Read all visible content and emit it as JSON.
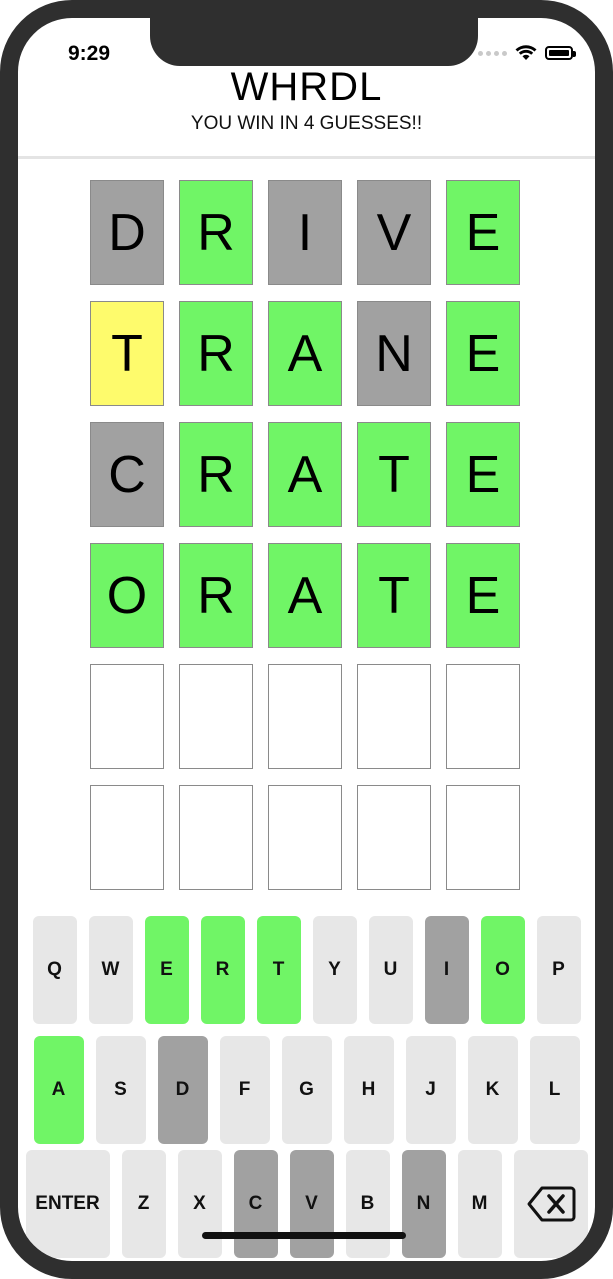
{
  "status": {
    "time": "9:29"
  },
  "header": {
    "title": "WHRDL",
    "subtitle": "YOU WIN IN 4 GUESSES!!"
  },
  "grid": [
    [
      {
        "l": "D",
        "s": "absent"
      },
      {
        "l": "R",
        "s": "correct"
      },
      {
        "l": "I",
        "s": "absent"
      },
      {
        "l": "V",
        "s": "absent"
      },
      {
        "l": "E",
        "s": "correct"
      }
    ],
    [
      {
        "l": "T",
        "s": "present"
      },
      {
        "l": "R",
        "s": "correct"
      },
      {
        "l": "A",
        "s": "correct"
      },
      {
        "l": "N",
        "s": "absent"
      },
      {
        "l": "E",
        "s": "correct"
      }
    ],
    [
      {
        "l": "C",
        "s": "absent"
      },
      {
        "l": "R",
        "s": "correct"
      },
      {
        "l": "A",
        "s": "correct"
      },
      {
        "l": "T",
        "s": "correct"
      },
      {
        "l": "E",
        "s": "correct"
      }
    ],
    [
      {
        "l": "O",
        "s": "correct"
      },
      {
        "l": "R",
        "s": "correct"
      },
      {
        "l": "A",
        "s": "correct"
      },
      {
        "l": "T",
        "s": "correct"
      },
      {
        "l": "E",
        "s": "correct"
      }
    ],
    [
      {
        "l": "",
        "s": "empty"
      },
      {
        "l": "",
        "s": "empty"
      },
      {
        "l": "",
        "s": "empty"
      },
      {
        "l": "",
        "s": "empty"
      },
      {
        "l": "",
        "s": "empty"
      }
    ],
    [
      {
        "l": "",
        "s": "empty"
      },
      {
        "l": "",
        "s": "empty"
      },
      {
        "l": "",
        "s": "empty"
      },
      {
        "l": "",
        "s": "empty"
      },
      {
        "l": "",
        "s": "empty"
      }
    ]
  ],
  "keyboard": {
    "rows": [
      [
        {
          "k": "Q",
          "s": ""
        },
        {
          "k": "W",
          "s": ""
        },
        {
          "k": "E",
          "s": "correct"
        },
        {
          "k": "R",
          "s": "correct"
        },
        {
          "k": "T",
          "s": "correct"
        },
        {
          "k": "Y",
          "s": ""
        },
        {
          "k": "U",
          "s": ""
        },
        {
          "k": "I",
          "s": "absent"
        },
        {
          "k": "O",
          "s": "correct"
        },
        {
          "k": "P",
          "s": ""
        }
      ],
      [
        {
          "k": "A",
          "s": "correct"
        },
        {
          "k": "S",
          "s": ""
        },
        {
          "k": "D",
          "s": "absent"
        },
        {
          "k": "F",
          "s": ""
        },
        {
          "k": "G",
          "s": ""
        },
        {
          "k": "H",
          "s": ""
        },
        {
          "k": "J",
          "s": ""
        },
        {
          "k": "K",
          "s": ""
        },
        {
          "k": "L",
          "s": ""
        }
      ],
      [
        {
          "k": "ENTER",
          "s": "",
          "wide": true
        },
        {
          "k": "Z",
          "s": ""
        },
        {
          "k": "X",
          "s": ""
        },
        {
          "k": "C",
          "s": "absent"
        },
        {
          "k": "V",
          "s": "absent"
        },
        {
          "k": "B",
          "s": ""
        },
        {
          "k": "N",
          "s": "absent"
        },
        {
          "k": "M",
          "s": ""
        },
        {
          "k": "backspace",
          "s": "",
          "wide": true,
          "icon": "backspace-icon"
        }
      ]
    ]
  },
  "colors": {
    "correct": "#70f566",
    "present": "#fefb6c",
    "absent": "#a1a1a1",
    "key": "#e7e7e7"
  }
}
